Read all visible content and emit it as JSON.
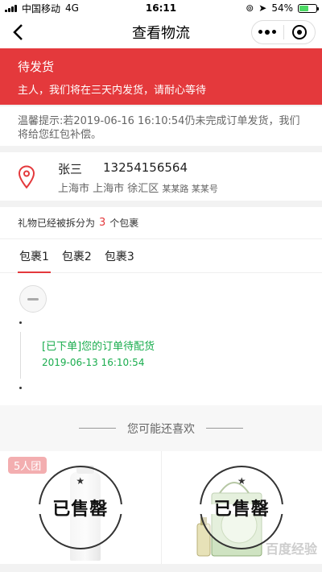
{
  "status_bar": {
    "carrier": "中国移动",
    "network": "4G",
    "time": "16:11",
    "battery": "54%",
    "battery_level": 0.54
  },
  "nav": {
    "title": "查看物流"
  },
  "banner": {
    "title": "待发货",
    "subtitle": "主人，我们将在三天内发货，请耐心等待"
  },
  "notice": {
    "text": "温馨提示:若2019-06-16 16:10:54仍未完成订单发货，我们将给您红包补偿。"
  },
  "address": {
    "name": "张三",
    "phone": "13254156564",
    "region": "上海市 上海市 徐汇区",
    "detail": "某某路 某某号"
  },
  "split": {
    "prefix": "礼物已经被拆分为",
    "count": "3",
    "suffix": "个包裹"
  },
  "tabs": [
    {
      "label": "包裹1"
    },
    {
      "label": "包裹2"
    },
    {
      "label": "包裹3"
    }
  ],
  "tracking": {
    "event_title": "[已下单]您的订单待配货",
    "event_time": "2019-06-13 16:10:54"
  },
  "recommend": {
    "title": "您可能还喜欢"
  },
  "products": [
    {
      "badge": "5人团",
      "status": "已售罄"
    },
    {
      "badge": "",
      "status": "已售罄"
    }
  ],
  "watermark": "百度经验",
  "colors": {
    "accent": "#e4393c",
    "success": "#1aad4e"
  }
}
